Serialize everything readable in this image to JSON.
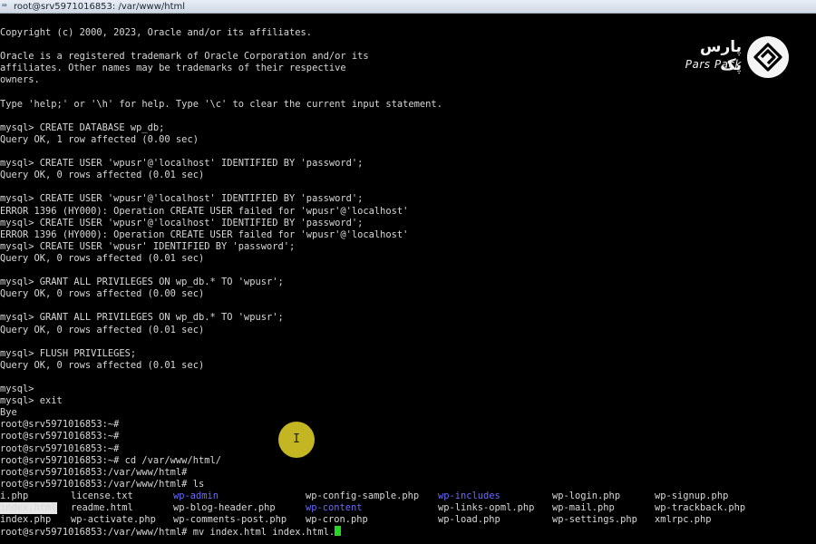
{
  "window": {
    "title": "root@srv5971016853: /var/www/html",
    "icon": "terminal-icon"
  },
  "brand": {
    "name_fa": "پارس پک",
    "name_en": "Pars Pack",
    "icon": "parspack-logo-icon"
  },
  "cursor_glyph": "I",
  "terminal": {
    "lines": [
      "Copyright (c) 2000, 2023, Oracle and/or its affiliates.",
      "",
      "Oracle is a registered trademark of Oracle Corporation and/or its",
      "affiliates. Other names may be trademarks of their respective",
      "owners.",
      "",
      "Type 'help;' or '\\h' for help. Type '\\c' to clear the current input statement.",
      "",
      "mysql> CREATE DATABASE wp_db;",
      "Query OK, 1 row affected (0.00 sec)",
      "",
      "mysql> CREATE USER 'wpusr'@'localhost' IDENTIFIED BY 'password';",
      "Query OK, 0 rows affected (0.01 sec)",
      "",
      "mysql> CREATE USER 'wpusr'@'localhost' IDENTIFIED BY 'password';",
      "ERROR 1396 (HY000): Operation CREATE USER failed for 'wpusr'@'localhost'",
      "mysql> CREATE USER 'wpusr'@'localhost' IDENTIFIED BY 'password';",
      "ERROR 1396 (HY000): Operation CREATE USER failed for 'wpusr'@'localhost'",
      "mysql> CREATE USER 'wpusr' IDENTIFIED BY 'password';",
      "Query OK, 0 rows affected (0.01 sec)",
      "",
      "mysql> GRANT ALL PRIVILEGES ON wp_db.* TO 'wpusr';",
      "Query OK, 0 rows affected (0.00 sec)",
      "",
      "mysql> GRANT ALL PRIVILEGES ON wp_db.* TO 'wpusr';",
      "Query OK, 0 rows affected (0.01 sec)",
      "",
      "mysql> FLUSH PRIVILEGES;",
      "Query OK, 0 rows affected (0.01 sec)",
      "",
      "mysql>",
      "mysql> exit",
      "Bye",
      "root@srv5971016853:~#",
      "root@srv5971016853:~#",
      "root@srv5971016853:~#",
      "root@srv5971016853:~# cd /var/www/html/",
      "root@srv5971016853:/var/www/html#",
      "root@srv5971016853:/var/www/html# ls"
    ],
    "ls_columns": [
      [
        "i.php",
        "index.html",
        "index.php"
      ],
      [
        "license.txt",
        "readme.html",
        "wp-activate.php"
      ],
      [
        "wp-admin",
        "wp-blog-header.php",
        "wp-comments-post.php"
      ],
      [
        "wp-config-sample.php",
        "wp-content",
        "wp-cron.php"
      ],
      [
        "wp-includes",
        "wp-links-opml.php",
        "wp-load.php"
      ],
      [
        "wp-login.php",
        "wp-mail.php",
        "wp-settings.php"
      ],
      [
        "wp-signup.php",
        "wp-trackback.php",
        "xmlrpc.php"
      ]
    ],
    "last_command": "root@srv5971016853:/var/www/html# mv index.html index.html."
  }
}
